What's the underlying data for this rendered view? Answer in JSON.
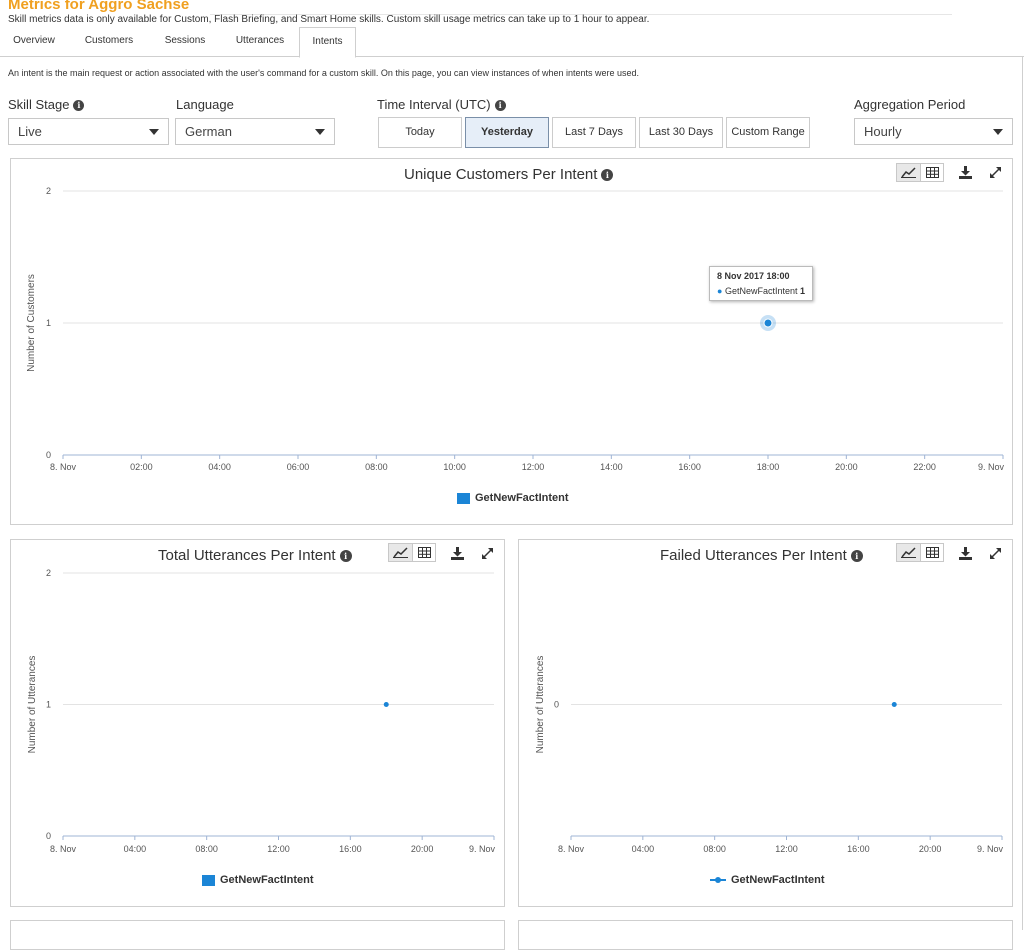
{
  "header": {
    "title": "Metrics for Aggro Sachse",
    "subtitle": "Skill metrics data is only available for Custom, Flash Briefing, and Smart Home skills. Custom skill usage metrics can take up to 1 hour to appear."
  },
  "tabs": [
    {
      "label": "Overview",
      "active": false
    },
    {
      "label": "Customers",
      "active": false
    },
    {
      "label": "Sessions",
      "active": false
    },
    {
      "label": "Utterances",
      "active": false
    },
    {
      "label": "Intents",
      "active": true
    }
  ],
  "intro": "An intent is the main request or action associated with the user's command for a custom skill. On this page, you can view instances of when intents were used.",
  "controls": {
    "skill_stage": {
      "label": "Skill Stage",
      "value": "Live"
    },
    "language": {
      "label": "Language",
      "value": "German"
    },
    "time_interval": {
      "label": "Time Interval (UTC)",
      "options": [
        "Today",
        "Yesterday",
        "Last 7 Days",
        "Last 30 Days",
        "Custom Range"
      ],
      "selected": "Yesterday"
    },
    "aggregation": {
      "label": "Aggregation Period",
      "value": "Hourly"
    }
  },
  "colors": {
    "series": "#1b85d6",
    "title_accent": "#f0a020"
  },
  "icons": {
    "info": "info-icon",
    "line_chart": "line-chart-icon",
    "table": "table-icon",
    "download": "download-icon",
    "expand": "expand-icon"
  },
  "chart_data": [
    {
      "type": "scatter",
      "title": "Unique Customers Per Intent",
      "ylabel": "Number of Customers",
      "xlabel": "",
      "x_ticks": [
        "8. Nov",
        "02:00",
        "04:00",
        "06:00",
        "08:00",
        "10:00",
        "12:00",
        "14:00",
        "16:00",
        "18:00",
        "20:00",
        "22:00",
        "9. Nov"
      ],
      "xlim_hours": [
        0,
        24
      ],
      "y_ticks": [
        "0",
        "1",
        "2"
      ],
      "ylim": [
        0,
        2
      ],
      "grid": true,
      "series": [
        {
          "name": "GetNewFactIntent",
          "points": [
            {
              "x_hour": 18,
              "y": 1
            }
          ]
        }
      ],
      "legend": {
        "position": "bottom",
        "label": "GetNewFactIntent",
        "style": "box"
      },
      "tooltip": {
        "date": "8 Nov 2017 18:00",
        "series": "GetNewFactIntent",
        "value": "1"
      }
    },
    {
      "type": "scatter",
      "title": "Total Utterances Per Intent",
      "ylabel": "Number of Utterances",
      "xlabel": "",
      "x_ticks": [
        "8. Nov",
        "04:00",
        "08:00",
        "12:00",
        "16:00",
        "20:00",
        "9. Nov"
      ],
      "xlim_hours": [
        0,
        24
      ],
      "y_ticks": [
        "0",
        "1",
        "2"
      ],
      "ylim": [
        0,
        2
      ],
      "grid": true,
      "series": [
        {
          "name": "GetNewFactIntent",
          "points": [
            {
              "x_hour": 18,
              "y": 1
            }
          ]
        }
      ],
      "legend": {
        "position": "bottom",
        "label": "GetNewFactIntent",
        "style": "box"
      }
    },
    {
      "type": "line",
      "title": "Failed Utterances Per Intent",
      "ylabel": "Number of Utterances",
      "xlabel": "",
      "x_ticks": [
        "8. Nov",
        "04:00",
        "08:00",
        "12:00",
        "16:00",
        "20:00",
        "9. Nov"
      ],
      "xlim_hours": [
        0,
        24
      ],
      "y_ticks": [
        "0"
      ],
      "ylim": [
        -1,
        1
      ],
      "grid": true,
      "series": [
        {
          "name": "GetNewFactIntent",
          "points": [
            {
              "x_hour": 18,
              "y": 0
            }
          ]
        }
      ],
      "legend": {
        "position": "bottom",
        "label": "GetNewFactIntent",
        "style": "line"
      }
    }
  ]
}
